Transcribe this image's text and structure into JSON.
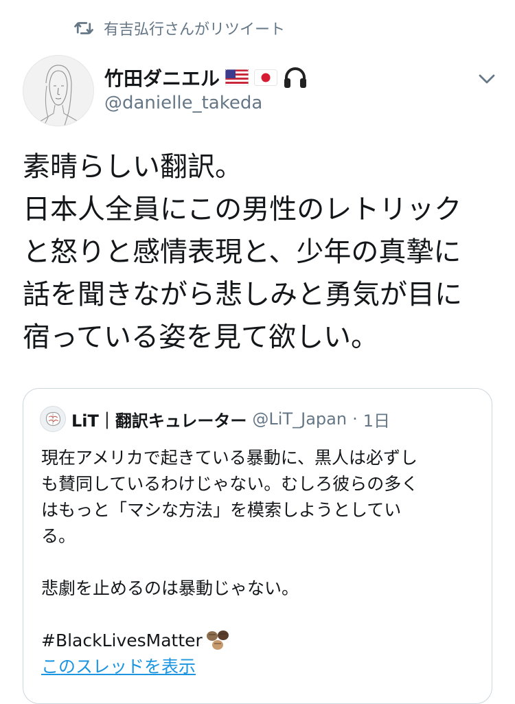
{
  "retweet": {
    "icon": "retweet-icon",
    "text": "有吉弘行さんがリツイート"
  },
  "author": {
    "display_name": "竹田ダニエル",
    "emojis": [
      "us-flag-icon",
      "japan-flag-icon",
      "headphones-icon"
    ],
    "handle": "@danielle_takeda"
  },
  "tweet": {
    "lines": [
      "素晴らしい翻訳。",
      "日本人全員にこの男性のレトリック",
      "と怒りと感情表現と、少年の真摯に",
      "話を聞きながら悲しみと勇気が目に",
      "宿っている姿を見て欲しい。"
    ]
  },
  "quote": {
    "name": "LiT｜翻訳キュレーター",
    "handle": "@LiT_Japan",
    "separator": "·",
    "time": "1日",
    "lines": [
      "現在アメリカで起きている暴動に、黒人は必ずし",
      "も賛同しているわけじゃない。むしろ彼らの多く",
      "はもっと「マシな方法」を模索しようとしてい",
      "る。",
      "",
      "悲劇を止めるのは暴動じゃない。",
      ""
    ],
    "hashtag": "#BlackLivesMatter",
    "hashtag_emoji": "raised-fists-icon",
    "show_thread": "このスレッドを表示"
  },
  "colors": {
    "text": "#14171a",
    "secondary": "#657786",
    "link": "#1b95e0",
    "border": "#ccd6dd"
  }
}
